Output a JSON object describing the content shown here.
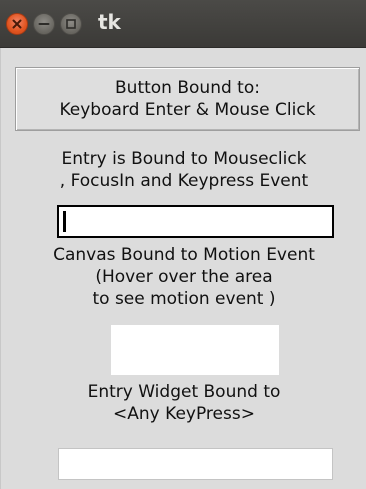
{
  "window": {
    "title": "tk",
    "icons": {
      "close": "close-icon",
      "minimize": "minimize-icon",
      "maximize": "maximize-icon"
    }
  },
  "button": {
    "line1": "Button Bound to:",
    "line2": "Keyboard Enter & Mouse Click"
  },
  "entry_label": {
    "line1": "Entry is Bound to Mouseclick",
    "line2": ", FocusIn and Keypress Event"
  },
  "entry": {
    "value": ""
  },
  "canvas_label": {
    "line1": "Canvas Bound to Motion Event",
    "line2": "(Hover over the area",
    "line3": "to see motion event )"
  },
  "entry2_label": {
    "line1": "Entry Widget Bound to",
    "line2": "<Any KeyPress>"
  },
  "entry2": {
    "value": ""
  },
  "colors": {
    "titlebar": "#3c3b37",
    "close_button": "#e1541f",
    "window_bg": "#dcdcdc"
  }
}
